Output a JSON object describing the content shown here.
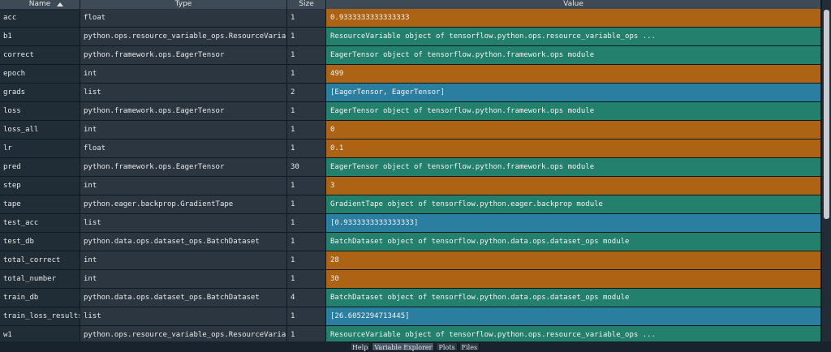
{
  "columns": {
    "name": "Name",
    "type": "Type",
    "size": "Size",
    "value": "Value"
  },
  "variables": [
    {
      "name": "acc",
      "type": "float",
      "size": "1",
      "value": "0.9333333333333333",
      "kind": "float"
    },
    {
      "name": "b1",
      "type": "python.ops.resource_variable_ops.ResourceVariable",
      "size": "1",
      "value": "ResourceVariable object of tensorflow.python.ops.resource_variable_ops ...",
      "kind": "obj"
    },
    {
      "name": "correct",
      "type": "python.framework.ops.EagerTensor",
      "size": "1",
      "value": "EagerTensor object of tensorflow.python.framework.ops module",
      "kind": "obj"
    },
    {
      "name": "epoch",
      "type": "int",
      "size": "1",
      "value": "499",
      "kind": "int"
    },
    {
      "name": "grads",
      "type": "list",
      "size": "2",
      "value": "[EagerTensor, EagerTensor]",
      "kind": "list"
    },
    {
      "name": "loss",
      "type": "python.framework.ops.EagerTensor",
      "size": "1",
      "value": "EagerTensor object of tensorflow.python.framework.ops module",
      "kind": "obj"
    },
    {
      "name": "loss_all",
      "type": "int",
      "size": "1",
      "value": "0",
      "kind": "int"
    },
    {
      "name": "lr",
      "type": "float",
      "size": "1",
      "value": "0.1",
      "kind": "float"
    },
    {
      "name": "pred",
      "type": "python.framework.ops.EagerTensor",
      "size": "30",
      "value": "EagerTensor object of tensorflow.python.framework.ops module",
      "kind": "obj"
    },
    {
      "name": "step",
      "type": "int",
      "size": "1",
      "value": "3",
      "kind": "int"
    },
    {
      "name": "tape",
      "type": "python.eager.backprop.GradientTape",
      "size": "1",
      "value": "GradientTape object of tensorflow.python.eager.backprop module",
      "kind": "obj"
    },
    {
      "name": "test_acc",
      "type": "list",
      "size": "1",
      "value": "[0.9333333333333333]",
      "kind": "list"
    },
    {
      "name": "test_db",
      "type": "python.data.ops.dataset_ops.BatchDataset",
      "size": "1",
      "value": "BatchDataset object of tensorflow.python.data.ops.dataset_ops module",
      "kind": "obj"
    },
    {
      "name": "total_correct",
      "type": "int",
      "size": "1",
      "value": "28",
      "kind": "int"
    },
    {
      "name": "total_number",
      "type": "int",
      "size": "1",
      "value": "30",
      "kind": "int"
    },
    {
      "name": "train_db",
      "type": "python.data.ops.dataset_ops.BatchDataset",
      "size": "4",
      "value": "BatchDataset object of tensorflow.python.data.ops.dataset_ops module",
      "kind": "obj"
    },
    {
      "name": "train_loss_results",
      "type": "list",
      "size": "1",
      "value": "[26.6052294713445]",
      "kind": "list"
    },
    {
      "name": "w1",
      "type": "python.ops.resource_variable_ops.ResourceVariable",
      "size": "1",
      "value": "ResourceVariable object of tensorflow.python.ops.resource_variable_ops ...",
      "kind": "obj"
    }
  ],
  "tabs": [
    "Help",
    "Variable Explorer",
    "Plots",
    "Files"
  ],
  "colors": {
    "numeric": "#ad6314",
    "object": "#23806c",
    "list": "#2a7ea0",
    "background": "#19232d"
  }
}
